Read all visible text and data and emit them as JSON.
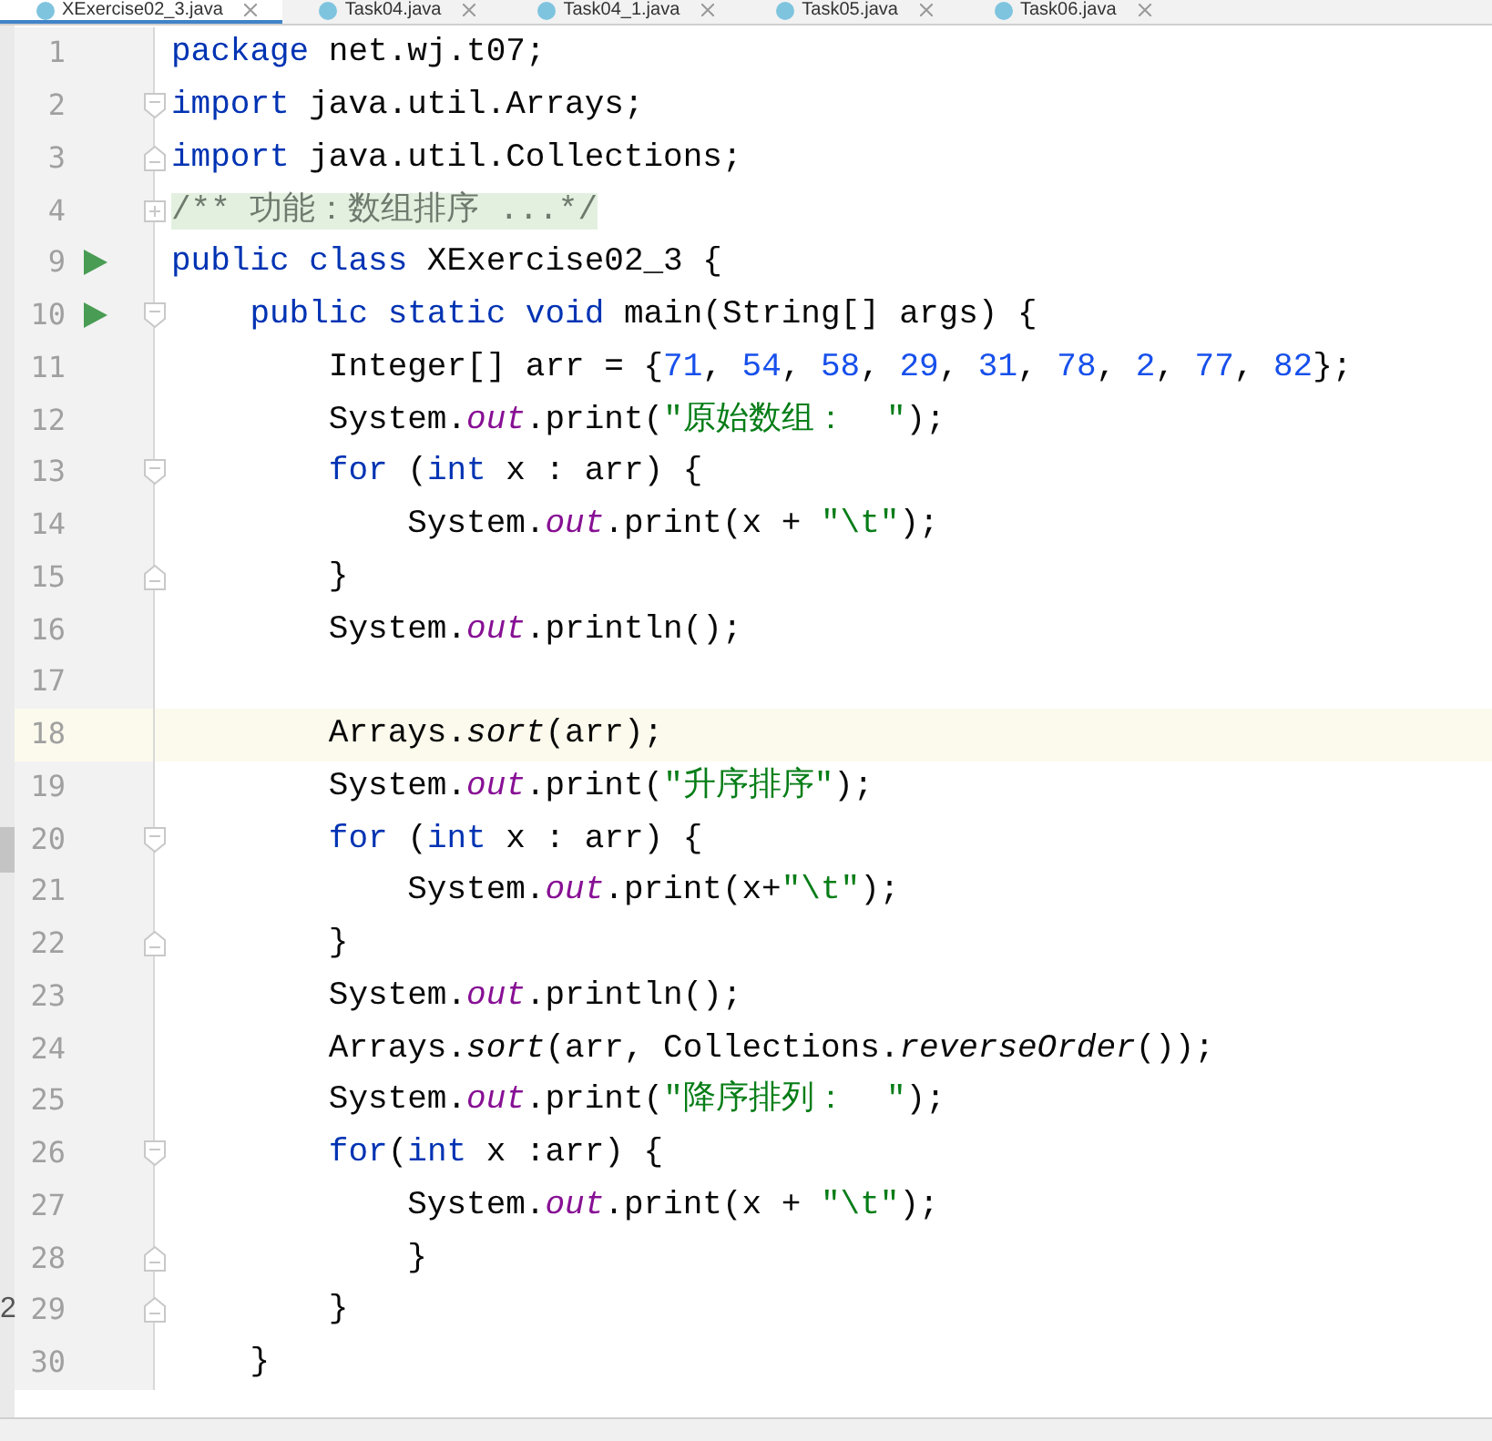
{
  "tabs": [
    {
      "label": "XExercise02_3.java",
      "selected": true
    },
    {
      "label": "Task04.java",
      "selected": false
    },
    {
      "label": "Task04_1.java",
      "selected": false
    },
    {
      "label": "Task05.java",
      "selected": false
    },
    {
      "label": "Task06.java",
      "selected": false
    }
  ],
  "lines": [
    {
      "number": "1",
      "tokens": [
        {
          "t": "package",
          "kind": "keyword"
        },
        {
          "t": " net.wj.t07;",
          "kind": "plain"
        }
      ]
    },
    {
      "number": "2",
      "fold_start": true,
      "tokens": [
        {
          "t": "import",
          "kind": "keyword"
        },
        {
          "t": " java.util.Arrays;",
          "kind": "plain"
        }
      ]
    },
    {
      "number": "3",
      "fold_end": true,
      "tokens": [
        {
          "t": "import",
          "kind": "keyword"
        },
        {
          "t": " java.util.Collections;",
          "kind": "plain"
        }
      ]
    },
    {
      "number": "4",
      "folded": true,
      "tokens": [
        {
          "t": "/** 功能：数组排序 ...*/",
          "kind": "folded"
        }
      ]
    },
    {
      "number": "9",
      "run": true,
      "tokens": [
        {
          "t": "public class",
          "kind": "keyword"
        },
        {
          "t": " XExercise02_3 {",
          "kind": "plain"
        }
      ]
    },
    {
      "number": "10",
      "run": true,
      "fold_start": true,
      "tokens": [
        {
          "t": "    public static void",
          "kind": "keyword"
        },
        {
          "t": " main(String[] args) {",
          "kind": "plain"
        }
      ]
    },
    {
      "number": "11",
      "tokens": [
        {
          "t": "        Integer[] arr = {",
          "kind": "plain"
        },
        {
          "t": "71",
          "kind": "number"
        },
        {
          "t": ", ",
          "kind": "plain"
        },
        {
          "t": "54",
          "kind": "number"
        },
        {
          "t": ", ",
          "kind": "plain"
        },
        {
          "t": "58",
          "kind": "number"
        },
        {
          "t": ", ",
          "kind": "plain"
        },
        {
          "t": "29",
          "kind": "number"
        },
        {
          "t": ", ",
          "kind": "plain"
        },
        {
          "t": "31",
          "kind": "number"
        },
        {
          "t": ", ",
          "kind": "plain"
        },
        {
          "t": "78",
          "kind": "number"
        },
        {
          "t": ", ",
          "kind": "plain"
        },
        {
          "t": "2",
          "kind": "number"
        },
        {
          "t": ", ",
          "kind": "plain"
        },
        {
          "t": "77",
          "kind": "number"
        },
        {
          "t": ", ",
          "kind": "plain"
        },
        {
          "t": "82",
          "kind": "number"
        },
        {
          "t": "};",
          "kind": "plain"
        }
      ]
    },
    {
      "number": "12",
      "tokens": [
        {
          "t": "        System.",
          "kind": "plain"
        },
        {
          "t": "out",
          "kind": "field"
        },
        {
          "t": ".print(",
          "kind": "plain"
        },
        {
          "t": "\"原始数组：  \"",
          "kind": "string"
        },
        {
          "t": ");",
          "kind": "plain"
        }
      ]
    },
    {
      "number": "13",
      "fold_start": true,
      "tokens": [
        {
          "t": "        for",
          "kind": "keyword"
        },
        {
          "t": " (",
          "kind": "plain"
        },
        {
          "t": "int",
          "kind": "keyword"
        },
        {
          "t": " x : arr) {",
          "kind": "plain"
        }
      ]
    },
    {
      "number": "14",
      "tokens": [
        {
          "t": "            System.",
          "kind": "plain"
        },
        {
          "t": "out",
          "kind": "field"
        },
        {
          "t": ".print(x + ",
          "kind": "plain"
        },
        {
          "t": "\"\\t\"",
          "kind": "string"
        },
        {
          "t": ");",
          "kind": "plain"
        }
      ]
    },
    {
      "number": "15",
      "fold_end": true,
      "tokens": [
        {
          "t": "        }",
          "kind": "plain"
        }
      ]
    },
    {
      "number": "16",
      "tokens": [
        {
          "t": "        System.",
          "kind": "plain"
        },
        {
          "t": "out",
          "kind": "field"
        },
        {
          "t": ".println();",
          "kind": "plain"
        }
      ]
    },
    {
      "number": "17"
    },
    {
      "number": "18",
      "selected": true,
      "tokens": [
        {
          "t": "        Arrays.",
          "kind": "plain"
        },
        {
          "t": "sort",
          "kind": "static"
        },
        {
          "t": "(arr);",
          "kind": "plain"
        }
      ]
    },
    {
      "number": "19",
      "tokens": [
        {
          "t": "        System.",
          "kind": "plain"
        },
        {
          "t": "out",
          "kind": "field"
        },
        {
          "t": ".print(",
          "kind": "plain"
        },
        {
          "t": "\"升序排序\"",
          "kind": "string"
        },
        {
          "t": ");",
          "kind": "plain"
        }
      ]
    },
    {
      "number": "20",
      "fold_start": true,
      "tokens": [
        {
          "t": "        for",
          "kind": "keyword"
        },
        {
          "t": " (",
          "kind": "plain"
        },
        {
          "t": "int",
          "kind": "keyword"
        },
        {
          "t": " x : arr) {",
          "kind": "plain"
        }
      ]
    },
    {
      "number": "21",
      "tokens": [
        {
          "t": "            System.",
          "kind": "plain"
        },
        {
          "t": "out",
          "kind": "field"
        },
        {
          "t": ".print(x+",
          "kind": "plain"
        },
        {
          "t": "\"\\t\"",
          "kind": "string"
        },
        {
          "t": ");",
          "kind": "plain"
        }
      ]
    },
    {
      "number": "22",
      "fold_end": true,
      "tokens": [
        {
          "t": "        }",
          "kind": "plain"
        }
      ]
    },
    {
      "number": "23",
      "tokens": [
        {
          "t": "        System.",
          "kind": "plain"
        },
        {
          "t": "out",
          "kind": "field"
        },
        {
          "t": ".println();",
          "kind": "plain"
        }
      ]
    },
    {
      "number": "24",
      "tokens": [
        {
          "t": "        Arrays.",
          "kind": "plain"
        },
        {
          "t": "sort",
          "kind": "static"
        },
        {
          "t": "(arr, Collections.",
          "kind": "plain"
        },
        {
          "t": "reverseOrder",
          "kind": "static"
        },
        {
          "t": "());",
          "kind": "plain"
        }
      ]
    },
    {
      "number": "25",
      "tokens": [
        {
          "t": "        System.",
          "kind": "plain"
        },
        {
          "t": "out",
          "kind": "field"
        },
        {
          "t": ".print(",
          "kind": "plain"
        },
        {
          "t": "\"降序排列：  \"",
          "kind": "string"
        },
        {
          "t": ");",
          "kind": "plain"
        }
      ]
    },
    {
      "number": "26",
      "fold_start": true,
      "tokens": [
        {
          "t": "        for",
          "kind": "keyword"
        },
        {
          "t": "(",
          "kind": "plain"
        },
        {
          "t": "int",
          "kind": "keyword"
        },
        {
          "t": " x :arr) {",
          "kind": "plain"
        }
      ]
    },
    {
      "number": "27",
      "tokens": [
        {
          "t": "            System.",
          "kind": "plain"
        },
        {
          "t": "out",
          "kind": "field"
        },
        {
          "t": ".print(x + ",
          "kind": "plain"
        },
        {
          "t": "\"\\t\"",
          "kind": "string"
        },
        {
          "t": ");",
          "kind": "plain"
        }
      ]
    },
    {
      "number": "28",
      "fold_end": true,
      "tokens": [
        {
          "t": "            }",
          "kind": "plain"
        }
      ]
    },
    {
      "number": "29",
      "fold_end": true,
      "side": "2",
      "tokens": [
        {
          "t": "        }",
          "kind": "plain"
        }
      ]
    },
    {
      "number": "30",
      "tokens": [
        {
          "t": "    }",
          "kind": "plain"
        }
      ]
    }
  ]
}
